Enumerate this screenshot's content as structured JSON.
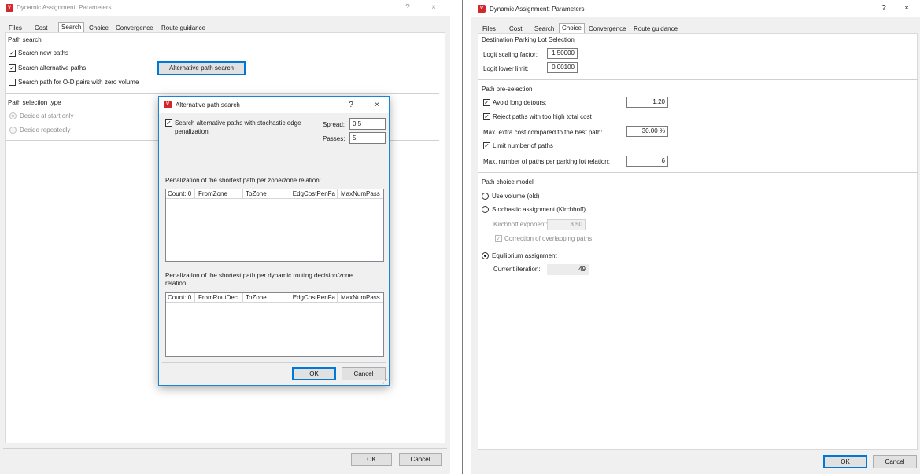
{
  "background_strip": "",
  "left_window": {
    "title": "Dynamic Assignment: Parameters",
    "help_btn": "?",
    "close_btn": "×",
    "tabs": [
      "Files",
      "Cost",
      "Search",
      "Choice",
      "Convergence",
      "Route guidance"
    ],
    "active_tab": "Search",
    "path_search_header": "Path search",
    "search_new_paths": "Search new paths",
    "search_alternative_paths": "Search alternative paths",
    "search_zero_volume": "Search path for O-D pairs with zero volume",
    "alt_path_button": "Alternative path search",
    "path_selection_header": "Path selection type",
    "decide_start": "Decide at start only",
    "decide_repeatedly": "Decide repeatedly",
    "ok": "OK",
    "cancel": "Cancel"
  },
  "alt_dialog": {
    "title": "Alternative path search",
    "help_btn": "?",
    "close_btn": "×",
    "stochastic_label_1": "Search alternative paths with stochastic edge",
    "stochastic_label_2": "penalization",
    "spread_label": "Spread:",
    "spread_value": "0.5",
    "passes_label": "Passes:",
    "passes_value": "5",
    "zone_header": "Penalization of the shortest path per zone/zone relation:",
    "zone_columns": [
      "Count: 0",
      "FromZone",
      "ToZone",
      "EdgCostPenFa",
      "MaxNumPass"
    ],
    "routing_header_1": "Penalization of the shortest path per dynamic routing decision/zone",
    "routing_header_2": "relation:",
    "routing_columns": [
      "Count: 0",
      "FromRoutDec",
      "ToZone",
      "EdgCostPenFa",
      "MaxNumPass"
    ],
    "ok": "OK",
    "cancel": "Cancel"
  },
  "right_window": {
    "title": "Dynamic Assignment: Parameters",
    "help_btn": "?",
    "close_btn": "×",
    "tabs": [
      "Files",
      "Cost",
      "Search",
      "Choice",
      "Convergence",
      "Route guidance"
    ],
    "active_tab": "Choice",
    "dest_header": "Destination Parking Lot Selection",
    "logit_scaling_label": "Logit scaling factor:",
    "logit_scaling_value": "1.50000",
    "logit_lower_label": "Logit lower limit:",
    "logit_lower_value": "0.00100",
    "preselect_header": "Path pre-selection",
    "avoid_detours": "Avoid long detours:",
    "avoid_detours_value": "1.20",
    "reject_cost": "Reject paths with too high total cost",
    "max_extra_label": "Max. extra cost compared to the best path:",
    "max_extra_value": "30.00 %",
    "limit_paths": "Limit number of paths",
    "max_paths_label": "Max. number of paths per parking lot relation:",
    "max_paths_value": "6",
    "choice_model_header": "Path choice model",
    "use_volume": "Use volume (old)",
    "stochastic": "Stochastic assignment (Kirchhoff)",
    "kirchhoff_label": "Kirchhoff exponent:",
    "kirchhoff_value": "3.50",
    "correction": "Correction of overlapping paths",
    "equilibrium": "Equilibrium assignment",
    "iteration_label": "Current iteration:",
    "iteration_value": "49",
    "ok": "OK",
    "cancel": "Cancel"
  }
}
